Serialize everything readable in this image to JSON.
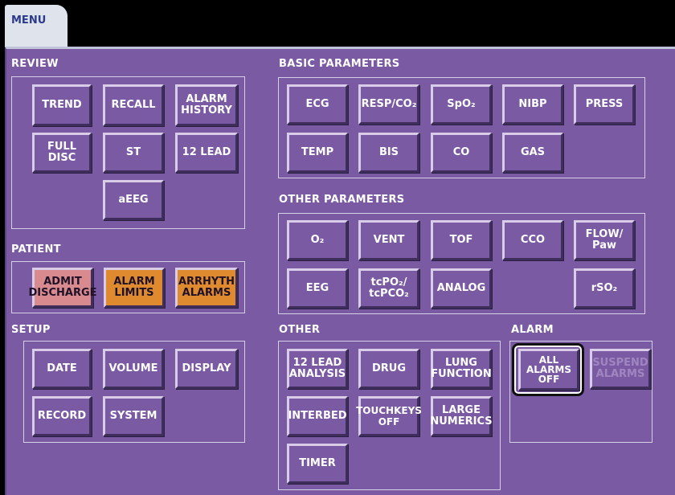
{
  "tab": {
    "label": "MENU"
  },
  "sections": {
    "review": "REVIEW",
    "basic_parameters": "BASIC PARAMETERS",
    "other_parameters": "OTHER PARAMETERS",
    "patient": "PATIENT",
    "setup": "SETUP",
    "other": "OTHER",
    "alarm": "ALARM"
  },
  "review": {
    "trend": "TREND",
    "recall": "RECALL",
    "alarm_history": "ALARM\nHISTORY",
    "full_disc": "FULL DISC",
    "st": "ST",
    "twelve_lead": "12 LEAD",
    "aeeg": "aEEG"
  },
  "basic": {
    "ecg": "ECG",
    "resp_co2": "RESP/CO₂",
    "spo2": "SpO₂",
    "nibp": "NIBP",
    "press": "PRESS",
    "temp": "TEMP",
    "bis": "BIS",
    "co": "CO",
    "gas": "GAS"
  },
  "other_params": {
    "o2": "O₂",
    "vent": "VENT",
    "tof": "TOF",
    "cco": "CCO",
    "flow_paw": "FLOW/\nPaw",
    "eeg": "EEG",
    "tcpo2": "tcPO₂/\ntcPCO₂",
    "analog": "ANALOG",
    "rso2": "rSO₂"
  },
  "patient": {
    "admit_discharge": "ADMIT\nDISCHARGE",
    "alarm_limits": "ALARM\nLIMITS",
    "arrhythmia_alarms": "ARRHYTH\nALARMS"
  },
  "setup": {
    "date": "DATE",
    "volume": "VOLUME",
    "display": "DISPLAY",
    "record": "RECORD",
    "system": "SYSTEM"
  },
  "other": {
    "twelve_lead_analysis": "12 LEAD\nANALYSIS",
    "drug": "DRUG",
    "lung_function": "LUNG\nFUNCTION",
    "interbed": "INTERBED",
    "touchkeys_off": "TOUCHKEYS\nOFF",
    "large_numerics": "LARGE\nNUMERICS",
    "timer": "TIMER"
  },
  "alarm": {
    "all_alarms_off": "ALL\nALARMS\nOFF",
    "suspend_alarms": "SUSPEND\nALARMS"
  },
  "colors": {
    "panel": "#7b5aa4",
    "pink": "#d98a8e",
    "orange": "#e08a30"
  }
}
